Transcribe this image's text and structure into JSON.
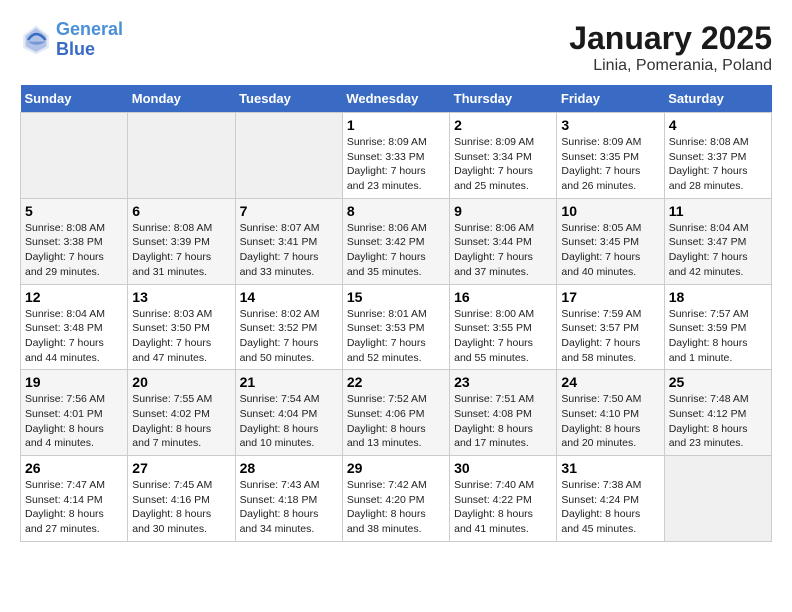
{
  "header": {
    "logo_line1": "General",
    "logo_line2": "Blue",
    "title": "January 2025",
    "subtitle": "Linia, Pomerania, Poland"
  },
  "weekdays": [
    "Sunday",
    "Monday",
    "Tuesday",
    "Wednesday",
    "Thursday",
    "Friday",
    "Saturday"
  ],
  "weeks": [
    [
      {
        "day": "",
        "info": ""
      },
      {
        "day": "",
        "info": ""
      },
      {
        "day": "",
        "info": ""
      },
      {
        "day": "1",
        "info": "Sunrise: 8:09 AM\nSunset: 3:33 PM\nDaylight: 7 hours\nand 23 minutes."
      },
      {
        "day": "2",
        "info": "Sunrise: 8:09 AM\nSunset: 3:34 PM\nDaylight: 7 hours\nand 25 minutes."
      },
      {
        "day": "3",
        "info": "Sunrise: 8:09 AM\nSunset: 3:35 PM\nDaylight: 7 hours\nand 26 minutes."
      },
      {
        "day": "4",
        "info": "Sunrise: 8:08 AM\nSunset: 3:37 PM\nDaylight: 7 hours\nand 28 minutes."
      }
    ],
    [
      {
        "day": "5",
        "info": "Sunrise: 8:08 AM\nSunset: 3:38 PM\nDaylight: 7 hours\nand 29 minutes."
      },
      {
        "day": "6",
        "info": "Sunrise: 8:08 AM\nSunset: 3:39 PM\nDaylight: 7 hours\nand 31 minutes."
      },
      {
        "day": "7",
        "info": "Sunrise: 8:07 AM\nSunset: 3:41 PM\nDaylight: 7 hours\nand 33 minutes."
      },
      {
        "day": "8",
        "info": "Sunrise: 8:06 AM\nSunset: 3:42 PM\nDaylight: 7 hours\nand 35 minutes."
      },
      {
        "day": "9",
        "info": "Sunrise: 8:06 AM\nSunset: 3:44 PM\nDaylight: 7 hours\nand 37 minutes."
      },
      {
        "day": "10",
        "info": "Sunrise: 8:05 AM\nSunset: 3:45 PM\nDaylight: 7 hours\nand 40 minutes."
      },
      {
        "day": "11",
        "info": "Sunrise: 8:04 AM\nSunset: 3:47 PM\nDaylight: 7 hours\nand 42 minutes."
      }
    ],
    [
      {
        "day": "12",
        "info": "Sunrise: 8:04 AM\nSunset: 3:48 PM\nDaylight: 7 hours\nand 44 minutes."
      },
      {
        "day": "13",
        "info": "Sunrise: 8:03 AM\nSunset: 3:50 PM\nDaylight: 7 hours\nand 47 minutes."
      },
      {
        "day": "14",
        "info": "Sunrise: 8:02 AM\nSunset: 3:52 PM\nDaylight: 7 hours\nand 50 minutes."
      },
      {
        "day": "15",
        "info": "Sunrise: 8:01 AM\nSunset: 3:53 PM\nDaylight: 7 hours\nand 52 minutes."
      },
      {
        "day": "16",
        "info": "Sunrise: 8:00 AM\nSunset: 3:55 PM\nDaylight: 7 hours\nand 55 minutes."
      },
      {
        "day": "17",
        "info": "Sunrise: 7:59 AM\nSunset: 3:57 PM\nDaylight: 7 hours\nand 58 minutes."
      },
      {
        "day": "18",
        "info": "Sunrise: 7:57 AM\nSunset: 3:59 PM\nDaylight: 8 hours\nand 1 minute."
      }
    ],
    [
      {
        "day": "19",
        "info": "Sunrise: 7:56 AM\nSunset: 4:01 PM\nDaylight: 8 hours\nand 4 minutes."
      },
      {
        "day": "20",
        "info": "Sunrise: 7:55 AM\nSunset: 4:02 PM\nDaylight: 8 hours\nand 7 minutes."
      },
      {
        "day": "21",
        "info": "Sunrise: 7:54 AM\nSunset: 4:04 PM\nDaylight: 8 hours\nand 10 minutes."
      },
      {
        "day": "22",
        "info": "Sunrise: 7:52 AM\nSunset: 4:06 PM\nDaylight: 8 hours\nand 13 minutes."
      },
      {
        "day": "23",
        "info": "Sunrise: 7:51 AM\nSunset: 4:08 PM\nDaylight: 8 hours\nand 17 minutes."
      },
      {
        "day": "24",
        "info": "Sunrise: 7:50 AM\nSunset: 4:10 PM\nDaylight: 8 hours\nand 20 minutes."
      },
      {
        "day": "25",
        "info": "Sunrise: 7:48 AM\nSunset: 4:12 PM\nDaylight: 8 hours\nand 23 minutes."
      }
    ],
    [
      {
        "day": "26",
        "info": "Sunrise: 7:47 AM\nSunset: 4:14 PM\nDaylight: 8 hours\nand 27 minutes."
      },
      {
        "day": "27",
        "info": "Sunrise: 7:45 AM\nSunset: 4:16 PM\nDaylight: 8 hours\nand 30 minutes."
      },
      {
        "day": "28",
        "info": "Sunrise: 7:43 AM\nSunset: 4:18 PM\nDaylight: 8 hours\nand 34 minutes."
      },
      {
        "day": "29",
        "info": "Sunrise: 7:42 AM\nSunset: 4:20 PM\nDaylight: 8 hours\nand 38 minutes."
      },
      {
        "day": "30",
        "info": "Sunrise: 7:40 AM\nSunset: 4:22 PM\nDaylight: 8 hours\nand 41 minutes."
      },
      {
        "day": "31",
        "info": "Sunrise: 7:38 AM\nSunset: 4:24 PM\nDaylight: 8 hours\nand 45 minutes."
      },
      {
        "day": "",
        "info": ""
      }
    ]
  ]
}
